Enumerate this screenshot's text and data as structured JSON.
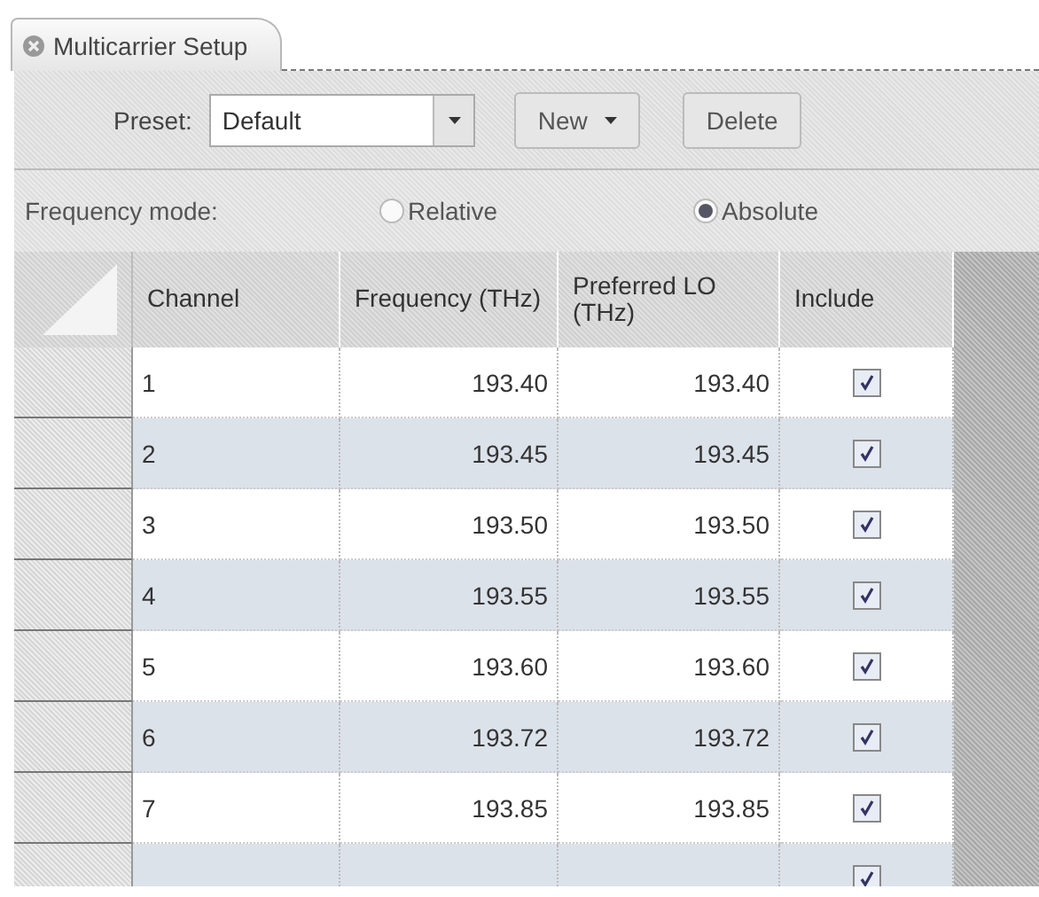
{
  "tab": {
    "title": "Multicarrier Setup"
  },
  "toolbar": {
    "preset_label": "Preset:",
    "preset_value": "Default",
    "new_button": "New",
    "delete_button": "Delete"
  },
  "frequency_mode": {
    "label": "Frequency mode:",
    "options": [
      {
        "label": "Relative",
        "selected": false
      },
      {
        "label": "Absolute",
        "selected": true
      }
    ]
  },
  "table": {
    "columns": [
      "Channel",
      "Frequency (THz)",
      "Preferred LO (THz)",
      "Include"
    ],
    "rows": [
      {
        "channel": "1",
        "frequency": "193.40",
        "preferred_lo": "193.40",
        "include": true
      },
      {
        "channel": "2",
        "frequency": "193.45",
        "preferred_lo": "193.45",
        "include": true
      },
      {
        "channel": "3",
        "frequency": "193.50",
        "preferred_lo": "193.50",
        "include": true
      },
      {
        "channel": "4",
        "frequency": "193.55",
        "preferred_lo": "193.55",
        "include": true
      },
      {
        "channel": "5",
        "frequency": "193.60",
        "preferred_lo": "193.60",
        "include": true
      },
      {
        "channel": "6",
        "frequency": "193.72",
        "preferred_lo": "193.72",
        "include": true
      },
      {
        "channel": "7",
        "frequency": "193.85",
        "preferred_lo": "193.85",
        "include": true
      },
      {
        "include": true
      }
    ]
  }
}
